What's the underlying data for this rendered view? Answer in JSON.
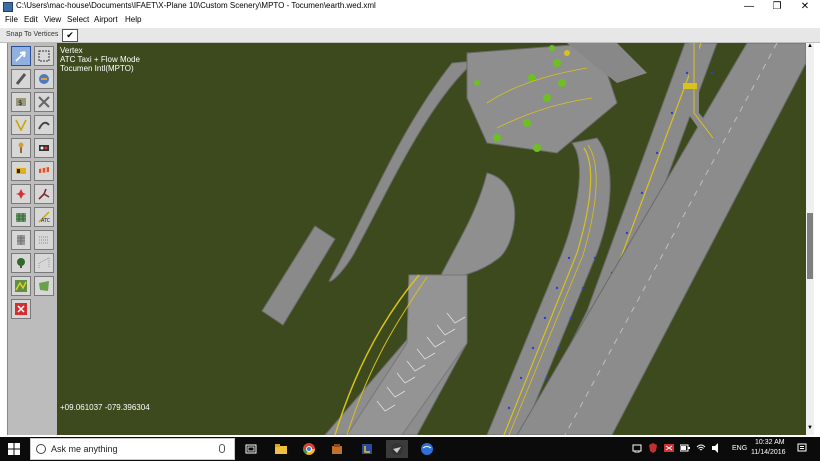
{
  "window": {
    "title": "C:\\Users\\mac-house\\Documents\\IFAET\\X-Plane 10\\Custom Scenery\\MPTO - Tocumen\\earth.wed.xml",
    "controls": {
      "minimize": "—",
      "maximize": "❐",
      "close": "✕"
    }
  },
  "menu": [
    "File",
    "Edit",
    "View",
    "Select",
    "Airport",
    "Help"
  ],
  "snapbar": {
    "label": "Snap To Vertices",
    "checked_mark": "✔"
  },
  "tools": [
    "vertex-tool",
    "marquee-tool",
    "runway-tool",
    "helipad-tool",
    "sealane-tool",
    "taxiway-tool",
    "taxilane-tool",
    "boundary-tool",
    "tower-viewpoint-tool",
    "light-fixture-tool",
    "sign-tool",
    "windsock-tool",
    "ramp-start-tool",
    "taxi-route-tool",
    "facade-tool",
    "atc-tool",
    "forest-tool",
    "polygon-tool",
    "object-tool",
    "line-tool",
    "string-tool",
    "draped-polygon-tool",
    "delete-tool"
  ],
  "map": {
    "info_lines": [
      "Vertex",
      "ATC Taxi + Flow Mode",
      "Tocumen Intl(MPTO)"
    ],
    "coordinates": "+09.061037 -079.396304",
    "colors": {
      "terrain": "#3d4a1d",
      "pavement": "#8e8e8e",
      "taxiline": "#d8c21c",
      "edge_light": "#2a3fd8"
    }
  },
  "taskbar": {
    "search_placeholder": "Ask me anything",
    "apps": [
      "task-view",
      "file-explorer",
      "chrome",
      "tools",
      "archive",
      "x-plane",
      "world-editor"
    ],
    "tray": {
      "language": "ENG",
      "time": "10:32 AM",
      "date": "11/14/2016"
    }
  }
}
